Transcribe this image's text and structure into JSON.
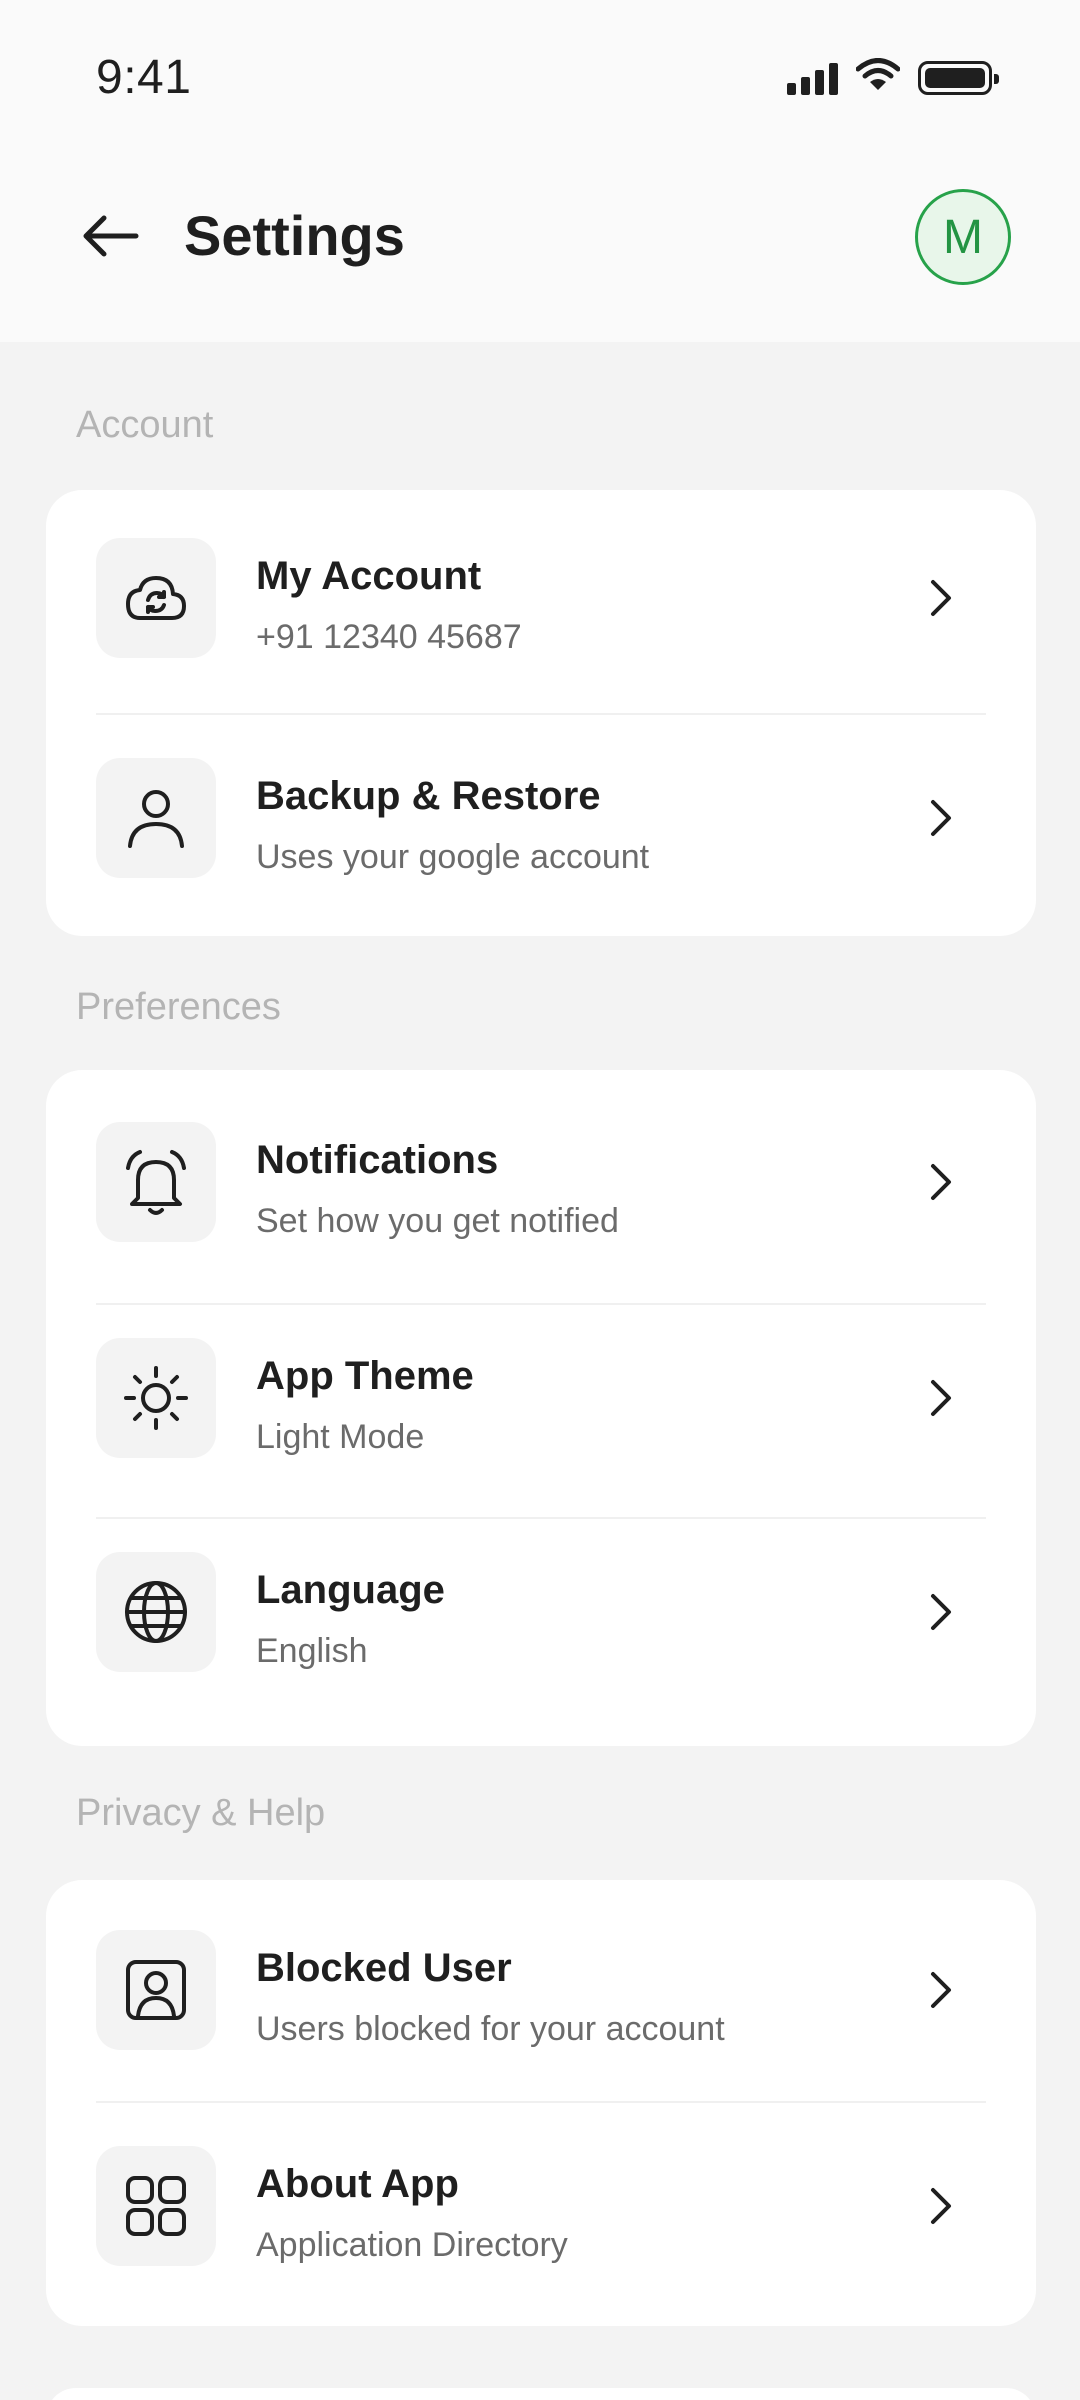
{
  "status_bar": {
    "time": "9:41"
  },
  "header": {
    "title": "Settings",
    "avatar_initial": "M"
  },
  "sections": {
    "account": {
      "label": "Account",
      "items": [
        {
          "title": "My Account",
          "subtitle": "+91 12340 45687",
          "icon": "cloud-sync-icon"
        },
        {
          "title": "Backup & Restore",
          "subtitle": "Uses your google account",
          "icon": "user-icon"
        }
      ]
    },
    "preferences": {
      "label": "Preferences",
      "items": [
        {
          "title": "Notifications",
          "subtitle": "Set how you get notified",
          "icon": "bell-icon"
        },
        {
          "title": "App Theme",
          "subtitle": "Light Mode",
          "icon": "sun-icon"
        },
        {
          "title": "Language",
          "subtitle": "English",
          "icon": "globe-icon"
        }
      ]
    },
    "privacy": {
      "label": "Privacy & Help",
      "items": [
        {
          "title": "Blocked User",
          "subtitle": "Users blocked for your account",
          "icon": "user-square-icon"
        },
        {
          "title": "About App",
          "subtitle": "Application Directory",
          "icon": "grid-icon"
        }
      ]
    }
  },
  "colors": {
    "accent_green": "#27a24a",
    "avatar_bg": "#e8f6ea",
    "page_bg": "#f3f3f3",
    "card_bg": "#ffffff"
  }
}
